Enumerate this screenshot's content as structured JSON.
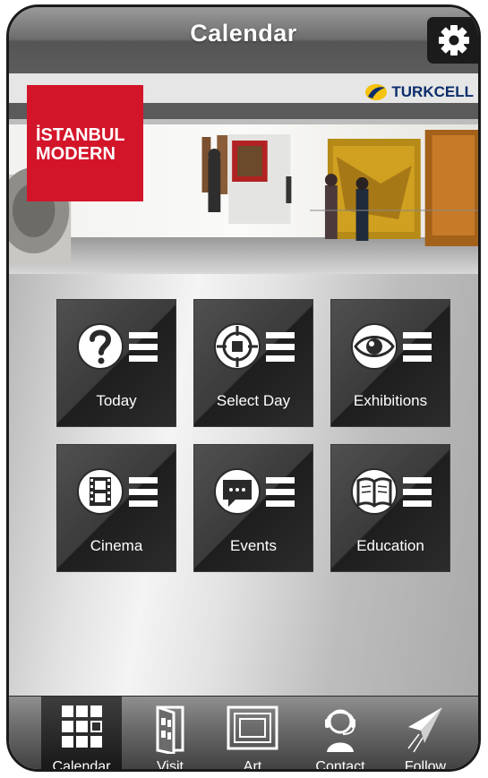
{
  "header": {
    "title": "Calendar",
    "settings_icon": "gear-icon"
  },
  "banner": {
    "logo_line1": "İSTANBUL",
    "logo_line2": "MODERN",
    "sponsor": "TURKCELL",
    "logo_color": "#d3152a"
  },
  "tiles": [
    {
      "label": "Today",
      "icon": "question-list-icon"
    },
    {
      "label": "Select Day",
      "icon": "target-list-icon"
    },
    {
      "label": "Exhibitions",
      "icon": "eye-list-icon"
    },
    {
      "label": "Cinema",
      "icon": "film-list-icon"
    },
    {
      "label": "Events",
      "icon": "speech-bubble-list-icon"
    },
    {
      "label": "Education",
      "icon": "book-list-icon"
    }
  ],
  "tabbar": {
    "active": "Calendar",
    "items": [
      {
        "label": "Calendar",
        "icon": "grid-icon"
      },
      {
        "label": "Visit",
        "icon": "door-icon"
      },
      {
        "label": "Art",
        "icon": "frame-icon"
      },
      {
        "label": "Contact",
        "icon": "headset-icon"
      },
      {
        "label": "Follow",
        "icon": "paper-plane-icon"
      }
    ]
  }
}
